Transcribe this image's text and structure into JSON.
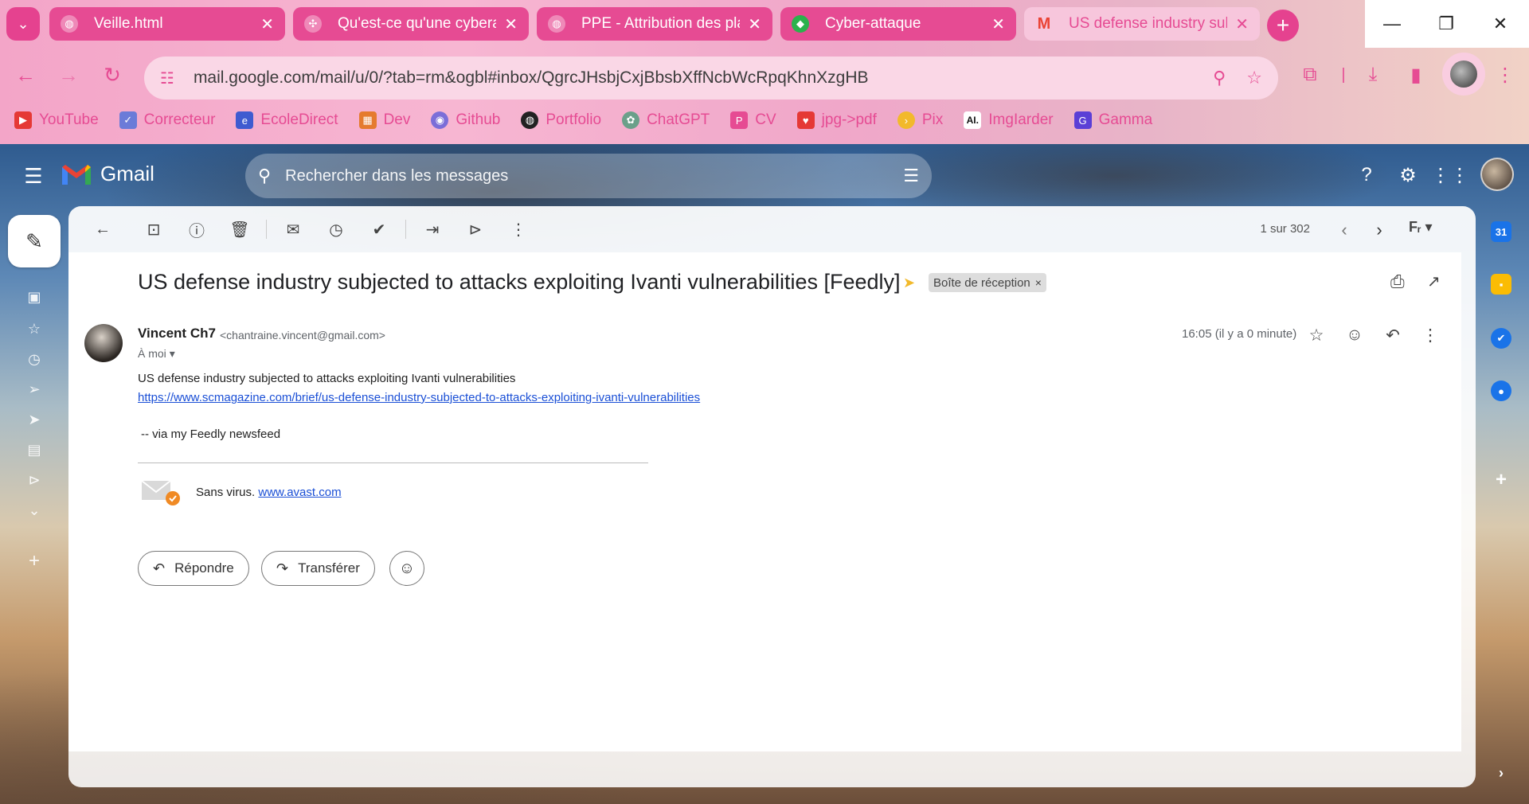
{
  "browser": {
    "tabs": [
      {
        "title": "Veille.html",
        "icon": "globe-icon"
      },
      {
        "title": "Qu'est-ce qu'une cyberat",
        "icon": "site-icon"
      },
      {
        "title": "PPE - Attribution des plac",
        "icon": "globe-icon"
      },
      {
        "title": "Cyber-attaque",
        "icon": "feedly-icon"
      },
      {
        "title": "US defense industry subj",
        "icon": "gmail-icon"
      }
    ],
    "url": "mail.google.com/mail/u/0/?tab=rm&ogbl#inbox/QgrcJHsbjCxjBbsbXffNcbWcRpqKhnXzgHB",
    "bookmarks": [
      {
        "label": "YouTube",
        "color": "#e53935"
      },
      {
        "label": "Correcteur",
        "color": "#6b7bd8"
      },
      {
        "label": "EcoleDirect",
        "color": "#3f5bd0"
      },
      {
        "label": "Dev",
        "color": "#e57b2e"
      },
      {
        "label": "Github",
        "color": "#7b6ed8"
      },
      {
        "label": "Portfolio",
        "color": "#222222"
      },
      {
        "label": "ChatGPT",
        "color": "#6aa08a"
      },
      {
        "label": "CV",
        "color": "#e64b93"
      },
      {
        "label": "jpg->pdf",
        "color": "#e53935"
      },
      {
        "label": "Pix",
        "color": "#f2b92b"
      },
      {
        "label": "ImgIarder",
        "color": "#111111"
      },
      {
        "label": "Gamma",
        "color": "#5a3fd6"
      }
    ],
    "bookmark_badges": {
      "imglarder": "AI."
    }
  },
  "gmail": {
    "brand": "Gmail",
    "search_placeholder": "Rechercher dans les messages",
    "pager": "1 sur 302",
    "email": {
      "subject": "US defense industry subjected to attacks exploiting Ivanti vulnerabilities [Feedly]",
      "label": "Boîte de réception",
      "label_close": "×",
      "sender_name": "Vincent Ch7",
      "sender_email": "<chantraine.vincent@gmail.com>",
      "recipient": "À moi",
      "timestamp": "16:05 (il y a 0 minute)",
      "body_line": "US defense industry subjected to attacks exploiting Ivanti vulnerabilities",
      "body_link": "https://www.scmagazine.com/brief/us-defense-industry-subjected-to-attacks-exploiting-ivanti-vulnerabilities",
      "via": "-- via my Feedly newsfeed",
      "avast_text": "Sans virus.",
      "avast_link": "www.avast.com"
    },
    "actions": {
      "reply": "Répondre",
      "forward": "Transférer"
    },
    "calendar_day": "31"
  },
  "colors": {
    "accent": "#e64b93",
    "gmail_link": "#1a4fd6",
    "important": "#f2b92b"
  }
}
